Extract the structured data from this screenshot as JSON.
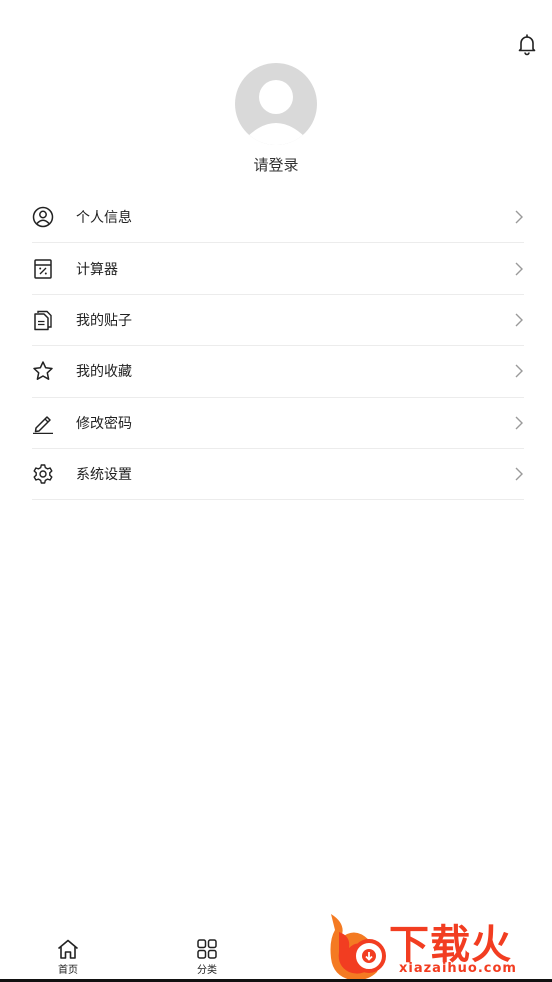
{
  "profile": {
    "login_prompt": "请登录"
  },
  "menu": [
    {
      "label": "个人信息",
      "icon": "user-circle-icon"
    },
    {
      "label": "计算器",
      "icon": "calculator-icon"
    },
    {
      "label": "我的贴子",
      "icon": "document-icon"
    },
    {
      "label": "我的收藏",
      "icon": "star-icon"
    },
    {
      "label": "修改密码",
      "icon": "edit-pen-icon"
    },
    {
      "label": "系统设置",
      "icon": "gear-icon"
    }
  ],
  "tabbar": {
    "home": "首页",
    "category": "分类"
  },
  "watermark": {
    "brand": "下载火",
    "url": "xiazaihuo.com"
  },
  "colors": {
    "accent": "#f23d21",
    "avatar": "#d9d9d9"
  }
}
